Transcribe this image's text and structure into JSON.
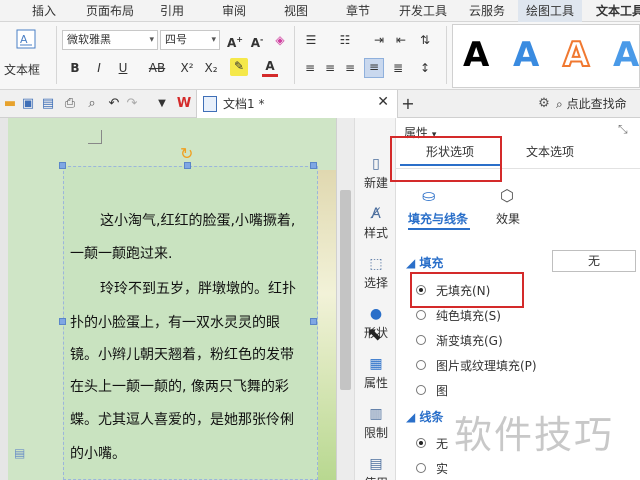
{
  "menu": {
    "tabs": [
      "插入",
      "页面布局",
      "引用",
      "审阅",
      "视图",
      "章节",
      "开发工具",
      "云服务",
      "绘图工具",
      "文本工具"
    ],
    "active": "绘图工具"
  },
  "ribbon": {
    "textbox_label": "文本框",
    "font_name": "微软雅黑",
    "font_size": "四号",
    "bold": "B",
    "italic": "I",
    "underline": "U",
    "strike": "AB",
    "superscript": "X²",
    "subscript": "X₂",
    "art_letter": "A",
    "art_colors": [
      "#000000",
      "#3a8be0",
      "#f07830",
      "#4a9ae8"
    ]
  },
  "quickbar": {
    "doc_tab": "文档1 *",
    "search_placeholder": "点此查找命"
  },
  "document": {
    "paragraphs": [
      "这小淘气,红红的脸蛋,小嘴撅着,",
      "一颠一颠跑过来.",
      "玲玲不到五岁，胖墩墩的。红扑",
      "扑的小脸蛋上，有一双水灵灵的眼",
      "镜。小辫儿朝天翘着，粉红色的发带",
      "在头上一颠一颠的, 像两只飞舞的彩",
      "蝶。尤其逗人喜爱的，是她那张伶俐",
      "的小嘴。"
    ]
  },
  "sidebar": {
    "items": [
      "新建",
      "样式",
      "选择",
      "形状",
      "属性",
      "限制",
      "使用"
    ]
  },
  "panel": {
    "title": "属性",
    "tabs": [
      "形状选项",
      "文本选项"
    ],
    "subtabs": [
      "填充与线条",
      "效果"
    ],
    "fill_section": "填充",
    "fill_none_button": "无",
    "fill_options": [
      "无填充(N)",
      "纯色填充(S)",
      "渐变填充(G)",
      "图片或纹理填充(P)",
      "图"
    ],
    "line_section": "线条",
    "line_options": [
      "无",
      "实"
    ]
  },
  "watermark": "软件技巧",
  "colors": {
    "accent_blue": "#2a6fc9",
    "highlight_red": "#d42a2a",
    "doc_bg": "#cfe5c6"
  }
}
